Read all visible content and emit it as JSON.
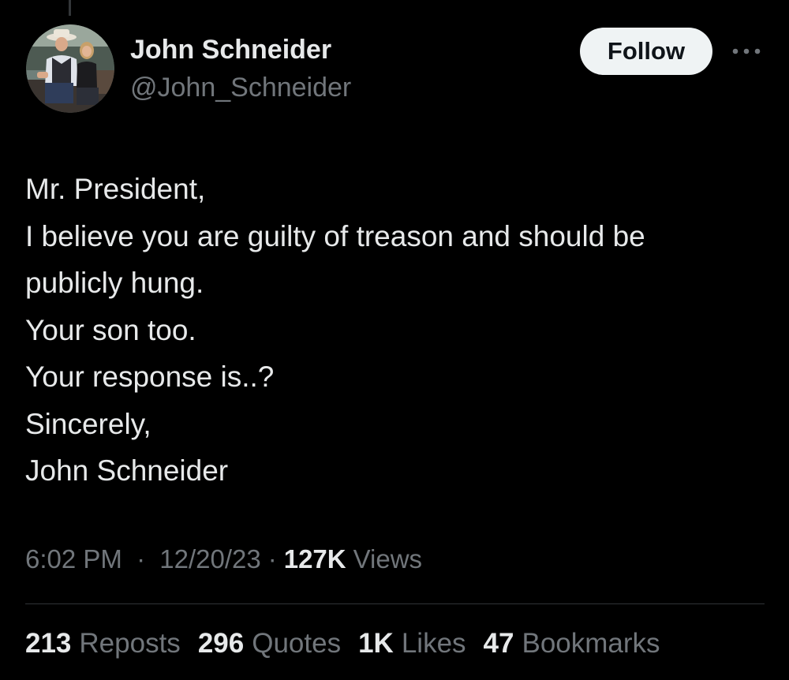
{
  "author": {
    "name": "John Schneider",
    "handle": "@John_Schneider"
  },
  "follow_button": {
    "label": "Follow"
  },
  "tweet": {
    "lines": [
      "Mr. President,",
      "I believe you are guilty of treason and should be",
      "publicly hung.",
      "Your son too.",
      "Your response is..?",
      "Sincerely,",
      "John Schneider"
    ]
  },
  "meta": {
    "time": "6:02 PM",
    "separator": "·",
    "date": "12/20/23",
    "views_count": "127K",
    "views_label": "Views"
  },
  "stats": {
    "reposts": {
      "count": "213",
      "label": "Reposts"
    },
    "quotes": {
      "count": "296",
      "label": "Quotes"
    },
    "likes": {
      "count": "1K",
      "label": "Likes"
    },
    "bookmarks": {
      "count": "47",
      "label": "Bookmarks"
    }
  },
  "icons": {
    "more": "more-horizontal-icon"
  },
  "colors": {
    "background": "#000000",
    "primary_text": "#e7e9ea",
    "secondary_text": "#71767b",
    "follow_bg": "#eff3f4",
    "divider": "#2f3336"
  }
}
